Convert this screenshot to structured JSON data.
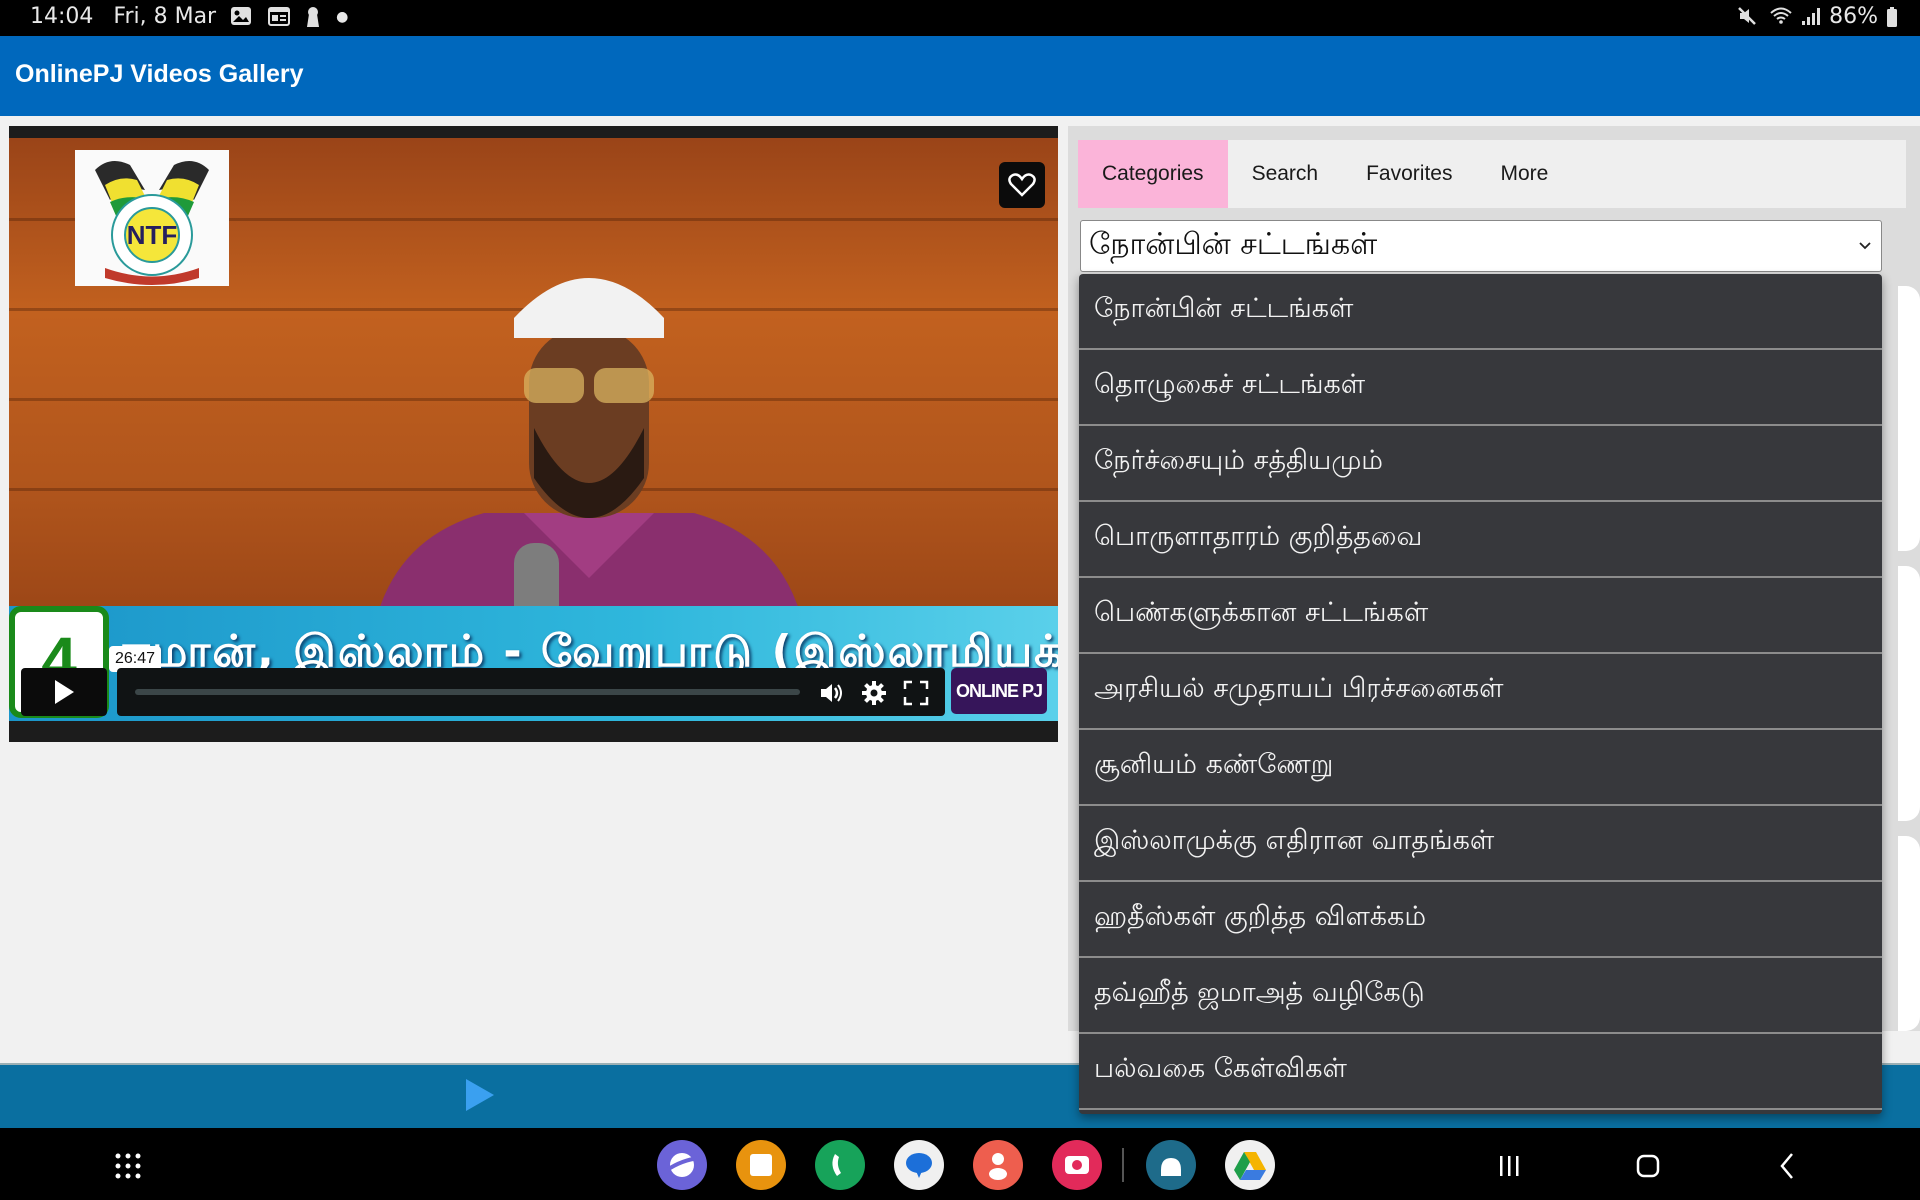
{
  "status_bar": {
    "time": "14:04",
    "date": "Fri, 8 Mar",
    "notification_icons": [
      "gallery-icon",
      "calendar-news-icon",
      "keyhole-icon",
      "dot-icon"
    ],
    "system_icons": [
      "mute-icon",
      "wifi-icon",
      "signal-icon"
    ],
    "battery": "86%"
  },
  "app_bar": {
    "title": "OnlinePJ Videos Gallery"
  },
  "video_player": {
    "logo_text": "NTF",
    "banner_number": "4",
    "banner_text": "ஈமான், இஸ்லாம் - வேறுபாடு (இஸ்லாமியக் கொள்கை",
    "hover_time": "26:47",
    "progress": 0.0,
    "brand_badge": "ONLINE PJ",
    "controls": [
      "play-icon",
      "volume-icon",
      "settings-icon",
      "fullscreen-icon"
    ],
    "favorite_icon": "heart-icon"
  },
  "tabs": [
    {
      "label": "Categories",
      "active": true
    },
    {
      "label": "Search",
      "active": false
    },
    {
      "label": "Favorites",
      "active": false
    },
    {
      "label": "More",
      "active": false
    }
  ],
  "category_select": {
    "selected": "நோன்பின் சட்டங்கள்",
    "options": [
      "நோன்பின் சட்டங்கள்",
      "தொழுகைச் சட்டங்கள்",
      "நேர்ச்சையும் சத்தியமும்",
      "பொருளாதாரம் குறித்தவை",
      "பெண்களுக்கான சட்டங்கள்",
      "அரசியல் சமுதாயப் பிரச்சனைகள்",
      "சூனியம் கண்ணேறு",
      "இஸ்லாமுக்கு எதிரான வாதங்கள்",
      "ஹதீஸ்கள் குறித்த விளக்கம்",
      "தவ்ஹீத் ஜமாஅத் வழிகேடு",
      "பல்வகை கேள்விகள்"
    ]
  },
  "colors": {
    "app_bar": "#0068bd",
    "active_tab": "#fbb4d9",
    "dropdown_bg": "#37383c",
    "bottom_banner": "#0a6fa0"
  },
  "nav_bar": {
    "apps": [
      "internet-app",
      "my-files-app",
      "phone-app",
      "messages-app",
      "contacts-app",
      "camera-app",
      "android-dev-app",
      "google-drive-app"
    ],
    "buttons": [
      "app-drawer",
      "recents",
      "home",
      "back"
    ]
  }
}
